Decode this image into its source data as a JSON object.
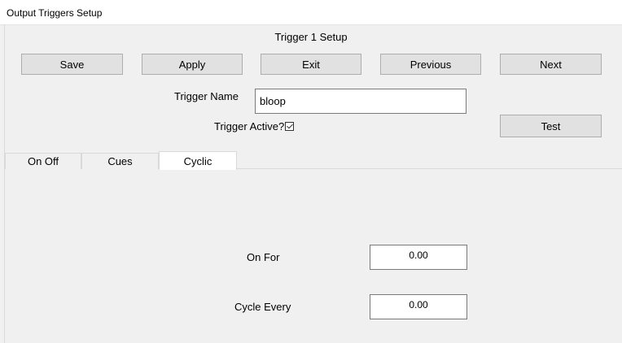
{
  "window": {
    "title": "Output Triggers Setup"
  },
  "header": {
    "title": "Trigger 1 Setup"
  },
  "toolbar": {
    "save_label": "Save",
    "apply_label": "Apply",
    "exit_label": "Exit",
    "previous_label": "Previous",
    "next_label": "Next"
  },
  "trigger": {
    "name_label": "Trigger Name",
    "name_value": "bloop",
    "active_label": "Trigger Active?",
    "active_checked": true,
    "test_label": "Test"
  },
  "tabs": [
    {
      "label": "On Off",
      "active": false
    },
    {
      "label": "Cues",
      "active": false
    },
    {
      "label": "Cyclic",
      "active": true
    }
  ],
  "cyclic": {
    "on_for_label": "On For",
    "on_for_value": "0.00",
    "cycle_every_label": "Cycle Every",
    "cycle_every_value": "0.00"
  }
}
